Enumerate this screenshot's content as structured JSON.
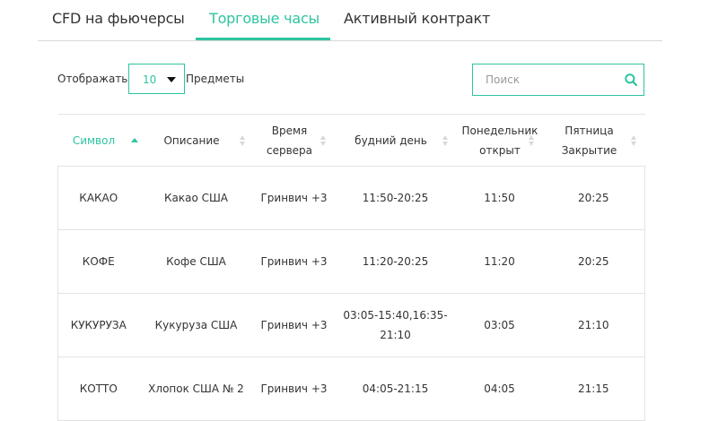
{
  "tabs": [
    {
      "label": "CFD на фьючерсы"
    },
    {
      "label": "Торговые часы",
      "active": true
    },
    {
      "label": "Активный контракт"
    }
  ],
  "controls": {
    "show_label": "Отображать",
    "length_value": "10",
    "items_label": "Предметы",
    "search_placeholder": "Поиск"
  },
  "table": {
    "headers": {
      "symbol": "Символ",
      "description": "Описание",
      "server_time": "Время сервера",
      "weekday": "будний день",
      "monday_open": "Понедельник открыт",
      "friday_close": "Пятница Закрытие"
    },
    "rows": [
      {
        "symbol": "КАКАО",
        "description": "Какао США",
        "server_time": "Гринвич +3",
        "weekday": "11:50-20:25",
        "monday_open": "11:50",
        "friday_close": "20:25"
      },
      {
        "symbol": "КОФЕ",
        "description": "Кофе США",
        "server_time": "Гринвич +3",
        "weekday": "11:20-20:25",
        "monday_open": "11:20",
        "friday_close": "20:25"
      },
      {
        "symbol": "КУКУРУЗА",
        "description": "Кукуруза США",
        "server_time": "Гринвич +3",
        "weekday": "03:05-15:40,16:35-21:10",
        "monday_open": "03:05",
        "friday_close": "21:10"
      },
      {
        "symbol": "КОТТО",
        "description": "Хлопок США № 2",
        "server_time": "Гринвич +3",
        "weekday": "04:05-21:15",
        "monday_open": "04:05",
        "friday_close": "21:15"
      }
    ]
  },
  "colors": {
    "accent": "#2ec4a0",
    "text": "#333333",
    "border": "#e3e3e3"
  }
}
